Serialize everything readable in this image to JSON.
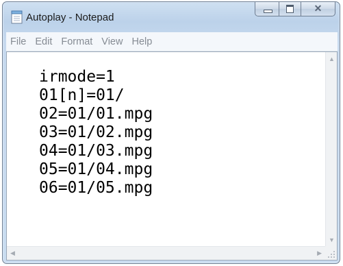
{
  "window": {
    "title": "Autoplay - Notepad",
    "caption_buttons": {
      "minimize": "minimize",
      "maximize": "maximize",
      "close": "✕"
    }
  },
  "menu": {
    "items": [
      {
        "label": "File"
      },
      {
        "label": "Edit"
      },
      {
        "label": "Format"
      },
      {
        "label": "View"
      },
      {
        "label": "Help"
      }
    ]
  },
  "editor": {
    "lines": [
      "irmode=1",
      "01[n]=01/",
      "02=01/01.mpg",
      "03=01/02.mpg",
      "04=01/03.mpg",
      "05=01/04.mpg",
      "06=01/05.mpg"
    ]
  },
  "scrollbars": {
    "up_arrow": "▲",
    "down_arrow": "▼",
    "left_arrow": "◀",
    "right_arrow": "▶"
  },
  "colors": {
    "titlebar": "#bcd2ea",
    "menubar": "#f4f7fb",
    "menu_text": "#858b93",
    "editor_bg": "#ffffff"
  }
}
